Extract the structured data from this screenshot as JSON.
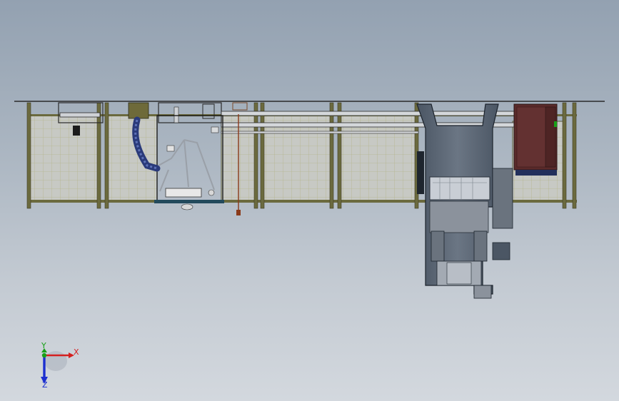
{
  "viewport": {
    "background_top": "#93a1b1",
    "background_bottom": "#d3d8de"
  },
  "triad": {
    "x_label": "X",
    "y_label": "Y",
    "z_label": "Z",
    "x_color": "#d42020",
    "y_color": "#18a018",
    "z_color": "#1c2fd0"
  },
  "model": {
    "frame_color": "#6b6a3e",
    "mesh_color": "#b9b98e",
    "press_color": "#55606e",
    "cabinet_color": "#5a2a2a",
    "robot_color": "#2a3a7a"
  }
}
